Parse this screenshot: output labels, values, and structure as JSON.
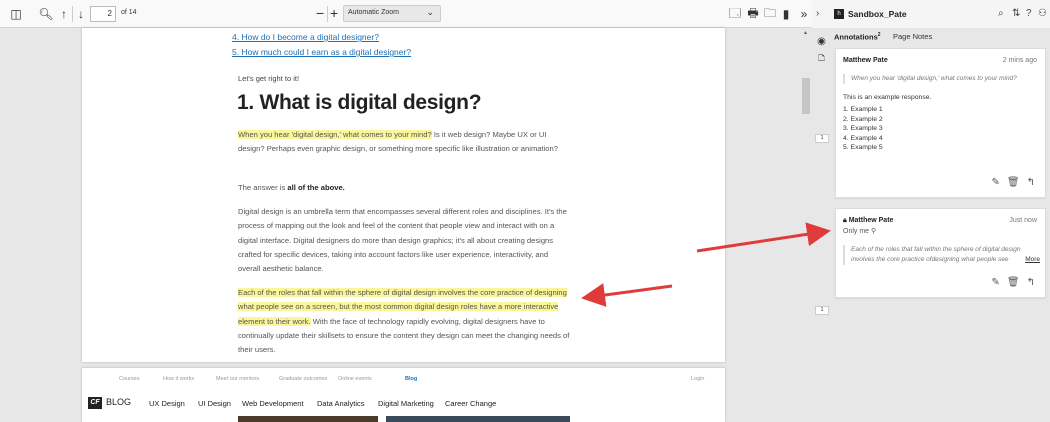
{
  "toolbar": {
    "page_number": "2",
    "page_of": "of 14",
    "zoom_out": "−",
    "zoom_in": "+",
    "zoom_value": "Automatic Zoom"
  },
  "document": {
    "toc_items": [
      "4. How do I become a digital designer?",
      "5. How much could I earn as a digital designer?"
    ],
    "intro": "Let's get right to it!",
    "heading": "1. What is digital design?",
    "para1_highlight": "When you hear 'digital design,' what comes to your mind?",
    "para1_rest": " Is it web design? Maybe UX or UI design? Perhaps even graphic design, or something more specific like illustration or animation?",
    "para2_pre": "The answer is ",
    "para2_bold": "all of the above.",
    "para3": "Digital design is an umbrella term that encompasses several different roles and disciplines. It's the process of mapping out the look and feel of the content that people view and interact with on a digital interface. Digital designers do more than design graphics; it's all about creating designs crafted for specific devices, taking into account factors like user experience, interactivity, and overall aesthetic balance.",
    "para4_highlight": "Each of the roles that fall within the sphere of digital design involves the core practice of designing what people see on a screen, but the most common digital design roles have a more interactive element to their work.",
    "para4_rest": " With the face of technology rapidly evolving, digital designers have to continually update their skillsets to ensure the content they design can meet the changing needs of their users."
  },
  "page2": {
    "nav": [
      "Courses",
      "How it works",
      "Meet our mentors",
      "Graduate outcomes",
      "Online events",
      "Blog"
    ],
    "login": "Login",
    "logo": "CF",
    "blog_label": "BLOG",
    "categories": [
      "UX Design",
      "UI Design",
      "Web Development",
      "Data Analytics",
      "Digital Marketing",
      "Career Change"
    ]
  },
  "sidebar": {
    "group_logo": "h",
    "group_name": "Sandbox_Pate",
    "tabs": {
      "annotations": "Annotations",
      "annotations_count": "2",
      "page_notes": "Page Notes"
    },
    "bucket_labels": [
      "1",
      "1"
    ],
    "annotations": [
      {
        "user": "Matthew Pate",
        "time": "2 mins ago",
        "quote": "When you hear 'digital design,' what comes to your mind?",
        "body_intro": "This is an example response.",
        "list": [
          "1. Example 1",
          "2. Example 2",
          "3. Example 3",
          "4. Example 4",
          "5. Example 5"
        ]
      },
      {
        "user": "Matthew Pate",
        "time": "Just now",
        "visibility": "Only me",
        "quote": "Each of the roles that fall within the sphere of digital design involves the core practice ofdesigning what people see",
        "more": "More"
      }
    ]
  },
  "colors": {
    "highlight": "#fbf69a",
    "link": "#1f6fb5",
    "arrow": "#e03a3a"
  }
}
